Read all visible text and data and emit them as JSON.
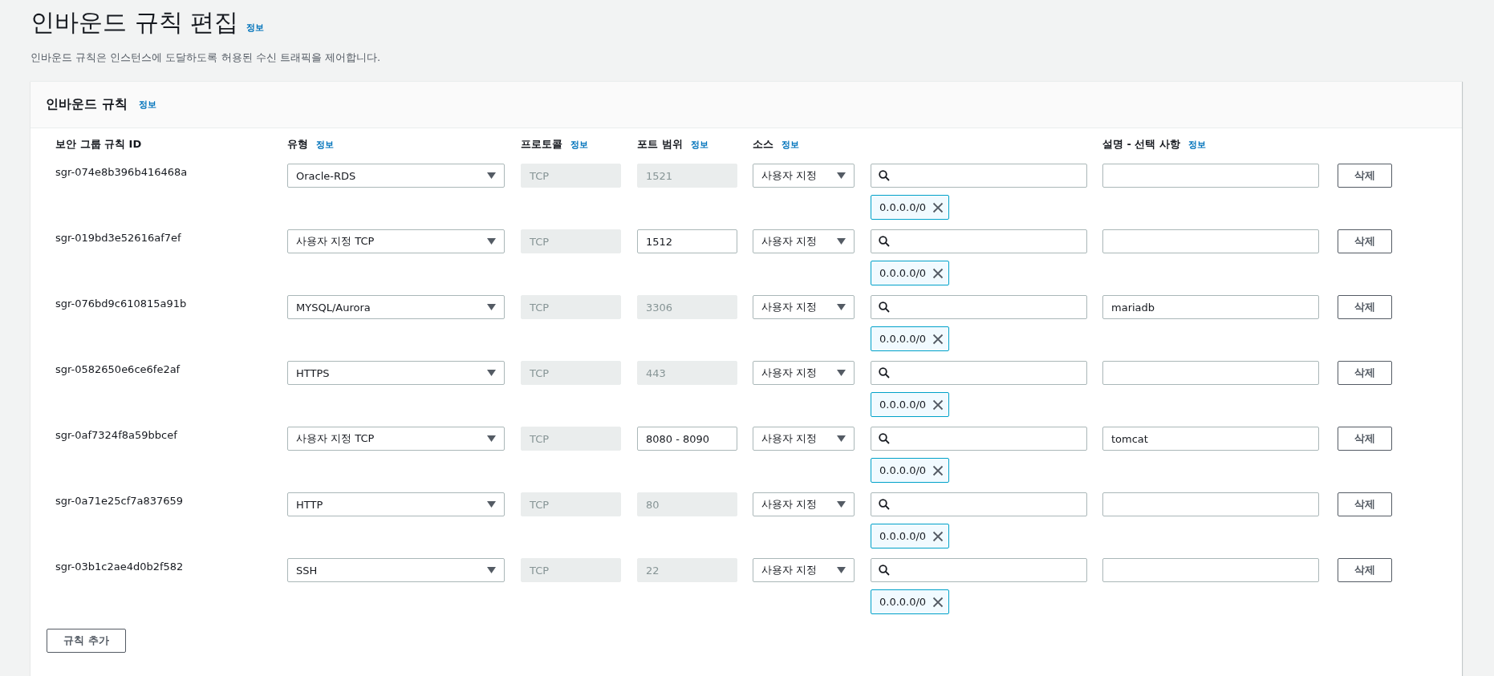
{
  "page": {
    "title": "인바운드 규칙 편집",
    "title_info": "정보",
    "description": "인바운드 규칙은 인스턴스에 도달하도록 허용된 수신 트래픽을 제어합니다."
  },
  "panel": {
    "title": "인바운드 규칙",
    "info": "정보",
    "columns": [
      {
        "label": "보안 그룹 규칙 ID"
      },
      {
        "label": "유형",
        "info": "정보"
      },
      {
        "label": "프로토콜",
        "info": "정보"
      },
      {
        "label": "포트 범위",
        "info": "정보"
      },
      {
        "label": "소스",
        "info": "정보"
      },
      {
        "label": "설명 - 선택 사항",
        "info": "정보"
      }
    ],
    "rules": [
      {
        "id": "sgr-074e8b396b416468a",
        "type": "Oracle-RDS",
        "protocol": "TCP",
        "port_range": {
          "value": "1521",
          "disabled": true
        },
        "source": "사용자 지정",
        "cidr": "0.0.0.0/0",
        "delete": "삭제"
      },
      {
        "id": "sgr-019bd3e52616af7ef",
        "type": "사용자 지정 TCP",
        "protocol": "TCP",
        "port_range": {
          "value": "1512",
          "disabled": false
        },
        "source": "사용자 지정",
        "cidr": "0.0.0.0/0",
        "delete": "삭제"
      },
      {
        "id": "sgr-076bd9c610815a91b",
        "type": "MYSQL/Aurora",
        "protocol": "TCP",
        "port_range": {
          "value": "3306",
          "disabled": true
        },
        "source": "사용자 지정",
        "cidr": "0.0.0.0/0",
        "description": "mariadb",
        "delete": "삭제"
      },
      {
        "id": "sgr-0582650e6ce6fe2af",
        "type": "HTTPS",
        "protocol": "TCP",
        "port_range": {
          "value": "443",
          "disabled": true
        },
        "source": "사용자 지정",
        "cidr": "0.0.0.0/0",
        "delete": "삭제"
      },
      {
        "id": "sgr-0af7324f8a59bbcef",
        "type": "사용자 지정 TCP",
        "protocol": "TCP",
        "port_range": {
          "value": "8080 - 8090",
          "disabled": false
        },
        "source": "사용자 지정",
        "cidr": "0.0.0.0/0",
        "description": "tomcat",
        "delete": "삭제"
      },
      {
        "id": "sgr-0a71e25cf7a837659",
        "type": "HTTP",
        "protocol": "TCP",
        "port_range": {
          "value": "80",
          "disabled": true
        },
        "source": "사용자 지정",
        "cidr": "0.0.0.0/0",
        "delete": "삭제"
      },
      {
        "id": "sgr-03b1c2ae4d0b2f582",
        "type": "SSH",
        "protocol": "TCP",
        "port_range": {
          "value": "22",
          "disabled": true
        },
        "source": "사용자 지정",
        "cidr": "0.0.0.0/0",
        "delete": "삭제"
      }
    ],
    "add_button": "규칙 추가"
  }
}
